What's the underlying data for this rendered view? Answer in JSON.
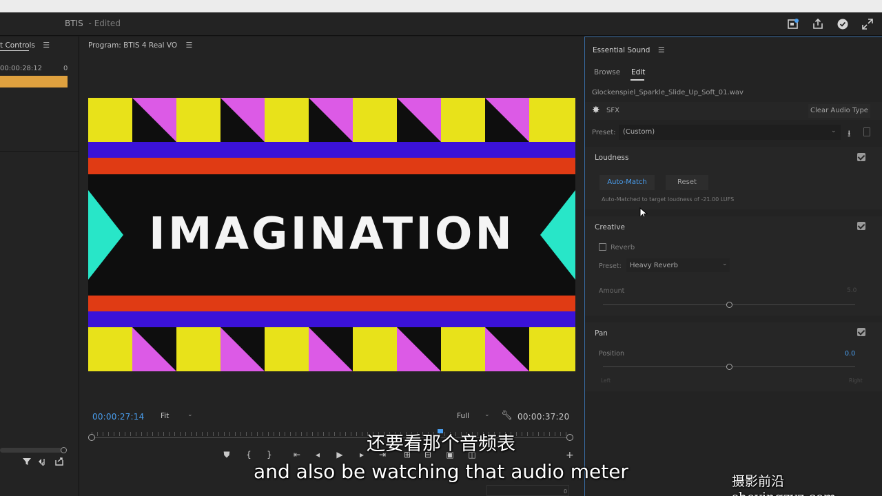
{
  "titlebar": {
    "title": "BTIS",
    "status": "- Edited",
    "icons": [
      "publish-icon",
      "share-icon",
      "check-icon",
      "fullscreen-icon"
    ]
  },
  "left_panel": {
    "tab": "t Controls",
    "timecode": "00:00:28:12",
    "zero": "0",
    "clip_color": "#dfa13f"
  },
  "program": {
    "title": "Program: BTIS 4 Real VO",
    "timecode_current": "00:00:27:14",
    "fit": "Fit",
    "quality": "Full",
    "timecode_duration": "00:00:37:20",
    "video_text": "IMAGINATION",
    "timecode_color": "#4a9ff0"
  },
  "essential_sound": {
    "title": "Essential Sound",
    "tabs": [
      "Browse",
      "Edit"
    ],
    "active_tab": "Edit",
    "clip_name": "Glockenspiel_Sparkle_Slide_Up_Soft_01.wav",
    "type_label": "SFX",
    "clear_button": "Clear Audio Type",
    "preset_label": "Preset:",
    "preset_value": "(Custom)",
    "loudness": {
      "title": "Loudness",
      "auto_match": "Auto-Match",
      "reset": "Reset",
      "hint": "Auto-Matched to target loudness of -21.00 LUFS"
    },
    "creative": {
      "title": "Creative",
      "reverb_label": "Reverb",
      "preset_label": "Preset:",
      "preset_value": "Heavy Reverb",
      "amount_label": "Amount",
      "amount_value": "5.0",
      "amount_level": 0.5
    },
    "pan": {
      "title": "Pan",
      "position_label": "Position",
      "position_value": "0.0",
      "left": "Left",
      "right": "Right",
      "position_level": 0.5
    }
  },
  "subtitles": {
    "chinese": "还要看那个音频表",
    "english": "and also be watching that audio meter"
  },
  "watermark": "摄影前沿 sheyingzyz.com"
}
